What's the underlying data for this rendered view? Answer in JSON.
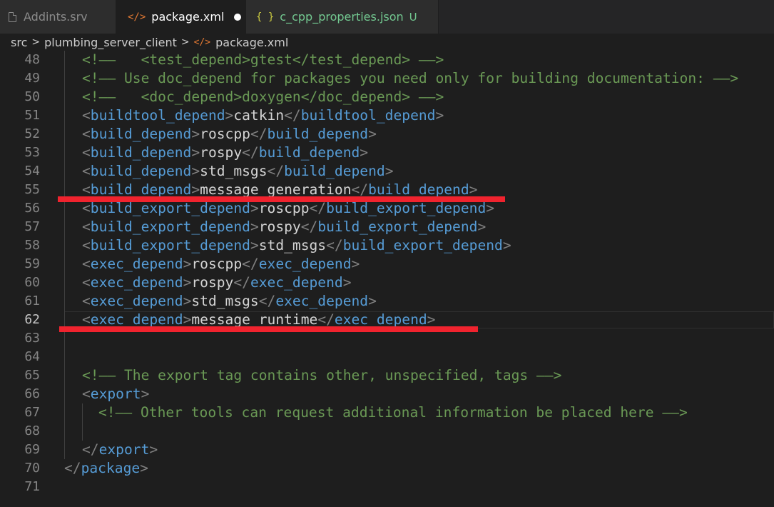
{
  "tabs": [
    {
      "icon": "file-icon",
      "label": "Addints.srv"
    },
    {
      "icon": "xml-icon",
      "icon_text": "</>",
      "label": "package.xml",
      "modified": true
    },
    {
      "icon": "json-icon",
      "icon_text": "{ }",
      "label": "c_cpp_properties.json",
      "badge": "U"
    }
  ],
  "breadcrumb": {
    "items": [
      "src",
      "plumbing_server_client",
      "package.xml"
    ],
    "separator": ">",
    "file_icon_text": "</>"
  },
  "colors": {
    "tag": "#569cd6",
    "bracket": "#808080",
    "text": "#d4d4d4",
    "comment": "#6a9955",
    "highlight": "#f0232e",
    "untracked": "#73c991"
  },
  "editor": {
    "active_line": "62",
    "lines": [
      {
        "n": "48",
        "indent": 1,
        "parts": [
          {
            "t": "com",
            "s": "<!——   <test_depend>gtest</test_depend> ——>"
          }
        ]
      },
      {
        "n": "49",
        "indent": 1,
        "parts": [
          {
            "t": "com",
            "s": "<!—— Use doc_depend for packages you need only for building documentation: ——>"
          }
        ]
      },
      {
        "n": "50",
        "indent": 1,
        "parts": [
          {
            "t": "com",
            "s": "<!——   <doc_depend>doxygen</doc_depend> ——>"
          }
        ]
      },
      {
        "n": "51",
        "indent": 1,
        "parts": [
          {
            "t": "br",
            "s": "<"
          },
          {
            "t": "tag",
            "s": "buildtool_depend"
          },
          {
            "t": "br",
            "s": ">"
          },
          {
            "t": "txt",
            "s": "catkin"
          },
          {
            "t": "br",
            "s": "</"
          },
          {
            "t": "tag",
            "s": "buildtool_depend"
          },
          {
            "t": "br",
            "s": ">"
          }
        ]
      },
      {
        "n": "52",
        "indent": 1,
        "parts": [
          {
            "t": "br",
            "s": "<"
          },
          {
            "t": "tag",
            "s": "build_depend"
          },
          {
            "t": "br",
            "s": ">"
          },
          {
            "t": "txt",
            "s": "roscpp"
          },
          {
            "t": "br",
            "s": "</"
          },
          {
            "t": "tag",
            "s": "build_depend"
          },
          {
            "t": "br",
            "s": ">"
          }
        ]
      },
      {
        "n": "53",
        "indent": 1,
        "parts": [
          {
            "t": "br",
            "s": "<"
          },
          {
            "t": "tag",
            "s": "build_depend"
          },
          {
            "t": "br",
            "s": ">"
          },
          {
            "t": "txt",
            "s": "rospy"
          },
          {
            "t": "br",
            "s": "</"
          },
          {
            "t": "tag",
            "s": "build_depend"
          },
          {
            "t": "br",
            "s": ">"
          }
        ]
      },
      {
        "n": "54",
        "indent": 1,
        "parts": [
          {
            "t": "br",
            "s": "<"
          },
          {
            "t": "tag",
            "s": "build_depend"
          },
          {
            "t": "br",
            "s": ">"
          },
          {
            "t": "txt",
            "s": "std_msgs"
          },
          {
            "t": "br",
            "s": "</"
          },
          {
            "t": "tag",
            "s": "build_depend"
          },
          {
            "t": "br",
            "s": ">"
          }
        ]
      },
      {
        "n": "55",
        "indent": 1,
        "parts": [
          {
            "t": "br",
            "s": "<"
          },
          {
            "t": "tag",
            "s": "build_depend"
          },
          {
            "t": "br",
            "s": ">"
          },
          {
            "t": "txt",
            "s": "message_generation"
          },
          {
            "t": "br",
            "s": "</"
          },
          {
            "t": "tag",
            "s": "build_depend"
          },
          {
            "t": "br",
            "s": ">"
          }
        ]
      },
      {
        "n": "56",
        "indent": 1,
        "parts": [
          {
            "t": "br",
            "s": "<"
          },
          {
            "t": "tag",
            "s": "build_export_depend"
          },
          {
            "t": "br",
            "s": ">"
          },
          {
            "t": "txt",
            "s": "roscpp"
          },
          {
            "t": "br",
            "s": "</"
          },
          {
            "t": "tag",
            "s": "build_export_depend"
          },
          {
            "t": "br",
            "s": ">"
          }
        ]
      },
      {
        "n": "57",
        "indent": 1,
        "parts": [
          {
            "t": "br",
            "s": "<"
          },
          {
            "t": "tag",
            "s": "build_export_depend"
          },
          {
            "t": "br",
            "s": ">"
          },
          {
            "t": "txt",
            "s": "rospy"
          },
          {
            "t": "br",
            "s": "</"
          },
          {
            "t": "tag",
            "s": "build_export_depend"
          },
          {
            "t": "br",
            "s": ">"
          }
        ]
      },
      {
        "n": "58",
        "indent": 1,
        "parts": [
          {
            "t": "br",
            "s": "<"
          },
          {
            "t": "tag",
            "s": "build_export_depend"
          },
          {
            "t": "br",
            "s": ">"
          },
          {
            "t": "txt",
            "s": "std_msgs"
          },
          {
            "t": "br",
            "s": "</"
          },
          {
            "t": "tag",
            "s": "build_export_depend"
          },
          {
            "t": "br",
            "s": ">"
          }
        ]
      },
      {
        "n": "59",
        "indent": 1,
        "parts": [
          {
            "t": "br",
            "s": "<"
          },
          {
            "t": "tag",
            "s": "exec_depend"
          },
          {
            "t": "br",
            "s": ">"
          },
          {
            "t": "txt",
            "s": "roscpp"
          },
          {
            "t": "br",
            "s": "</"
          },
          {
            "t": "tag",
            "s": "exec_depend"
          },
          {
            "t": "br",
            "s": ">"
          }
        ]
      },
      {
        "n": "60",
        "indent": 1,
        "parts": [
          {
            "t": "br",
            "s": "<"
          },
          {
            "t": "tag",
            "s": "exec_depend"
          },
          {
            "t": "br",
            "s": ">"
          },
          {
            "t": "txt",
            "s": "rospy"
          },
          {
            "t": "br",
            "s": "</"
          },
          {
            "t": "tag",
            "s": "exec_depend"
          },
          {
            "t": "br",
            "s": ">"
          }
        ]
      },
      {
        "n": "61",
        "indent": 1,
        "parts": [
          {
            "t": "br",
            "s": "<"
          },
          {
            "t": "tag",
            "s": "exec_depend"
          },
          {
            "t": "br",
            "s": ">"
          },
          {
            "t": "txt",
            "s": "std_msgs"
          },
          {
            "t": "br",
            "s": "</"
          },
          {
            "t": "tag",
            "s": "exec_depend"
          },
          {
            "t": "br",
            "s": ">"
          }
        ]
      },
      {
        "n": "62",
        "indent": 1,
        "parts": [
          {
            "t": "br",
            "s": "<"
          },
          {
            "t": "tag",
            "s": "exec_depend"
          },
          {
            "t": "br",
            "s": ">"
          },
          {
            "t": "txt",
            "s": "message_runtime"
          },
          {
            "t": "br",
            "s": "</"
          },
          {
            "t": "tag",
            "s": "exec_depend"
          },
          {
            "t": "br",
            "s": ">"
          }
        ]
      },
      {
        "n": "63",
        "indent": 0,
        "parts": []
      },
      {
        "n": "64",
        "indent": 0,
        "parts": []
      },
      {
        "n": "65",
        "indent": 1,
        "parts": [
          {
            "t": "com",
            "s": "<!—— The export tag contains other, unspecified, tags ——>"
          }
        ]
      },
      {
        "n": "66",
        "indent": 1,
        "parts": [
          {
            "t": "br",
            "s": "<"
          },
          {
            "t": "tag",
            "s": "export"
          },
          {
            "t": "br",
            "s": ">"
          }
        ]
      },
      {
        "n": "67",
        "indent": 2,
        "parts": [
          {
            "t": "com",
            "s": "<!—— Other tools can request additional information be placed here ——>"
          }
        ]
      },
      {
        "n": "68",
        "indent": 0,
        "parts": []
      },
      {
        "n": "69",
        "indent": 1,
        "parts": [
          {
            "t": "br",
            "s": "</"
          },
          {
            "t": "tag",
            "s": "export"
          },
          {
            "t": "br",
            "s": ">"
          }
        ]
      },
      {
        "n": "70",
        "indent": 0,
        "parts": [
          {
            "t": "br",
            "s": "</"
          },
          {
            "t": "tag",
            "s": "package"
          },
          {
            "t": "br",
            "s": ">"
          }
        ]
      },
      {
        "n": "71",
        "indent": 0,
        "parts": []
      }
    ]
  },
  "annotations": [
    {
      "name": "highlight-line-55",
      "target_line": "55"
    },
    {
      "name": "highlight-line-62",
      "target_line": "62"
    }
  ]
}
